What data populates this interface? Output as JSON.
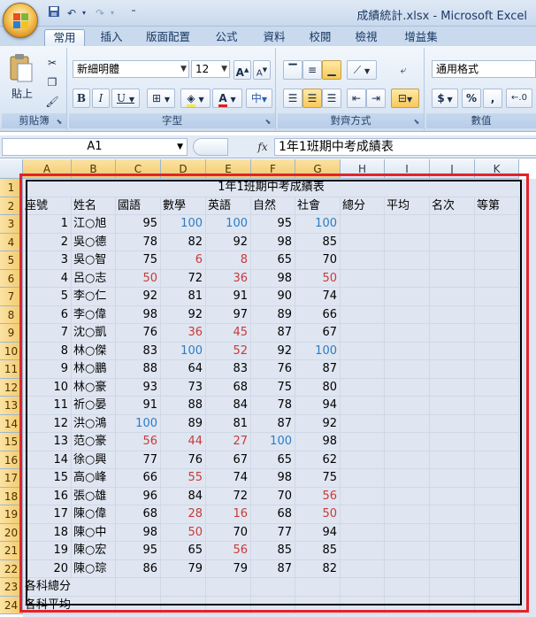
{
  "window": {
    "title": "成績統計.xlsx - Microsoft Excel"
  },
  "ribbon": {
    "tabs": [
      "常用",
      "插入",
      "版面配置",
      "公式",
      "資料",
      "校閱",
      "檢視",
      "增益集"
    ],
    "active_tab": "常用",
    "clipboard": {
      "label": "剪貼簿",
      "paste": "貼上"
    },
    "font": {
      "label": "字型",
      "name": "新細明體",
      "size": "12",
      "bold": "B",
      "italic": "I",
      "underline": "U",
      "grow": "A",
      "shrink": "A"
    },
    "alignment": {
      "label": "對齊方式"
    },
    "number": {
      "label": "數值",
      "format": "通用格式",
      "currency": "$",
      "percent": "%",
      "comma": ","
    }
  },
  "formula_bar": {
    "name_box": "A1",
    "fx": "fx",
    "content": "1年1班期中考成績表"
  },
  "columns": [
    "A",
    "B",
    "C",
    "D",
    "E",
    "F",
    "G",
    "H",
    "I",
    "J",
    "K"
  ],
  "rows": [
    "1",
    "2",
    "3",
    "4",
    "5",
    "6",
    "7",
    "8",
    "9",
    "10",
    "11",
    "12",
    "13",
    "14",
    "15",
    "16",
    "17",
    "18",
    "19",
    "20",
    "21",
    "22",
    "23",
    "24"
  ],
  "sheet": {
    "title": "1年1班期中考成績表",
    "headers": [
      "座號",
      "姓名",
      "國語",
      "數學",
      "英語",
      "自然",
      "社會",
      "總分",
      "平均",
      "名次",
      "等第"
    ],
    "students": [
      {
        "no": "1",
        "name": "江○旭",
        "scores": [
          "95",
          "100",
          "100",
          "95",
          "100"
        ]
      },
      {
        "no": "2",
        "name": "吳○德",
        "scores": [
          "78",
          "82",
          "92",
          "98",
          "85"
        ]
      },
      {
        "no": "3",
        "name": "吳○智",
        "scores": [
          "75",
          "6",
          "8",
          "65",
          "70"
        ]
      },
      {
        "no": "4",
        "name": "呂○志",
        "scores": [
          "50",
          "72",
          "36",
          "98",
          "50"
        ]
      },
      {
        "no": "5",
        "name": "李○仁",
        "scores": [
          "92",
          "81",
          "91",
          "90",
          "74"
        ]
      },
      {
        "no": "6",
        "name": "李○偉",
        "scores": [
          "98",
          "92",
          "97",
          "89",
          "66"
        ]
      },
      {
        "no": "7",
        "name": "沈○凱",
        "scores": [
          "76",
          "36",
          "45",
          "87",
          "67"
        ]
      },
      {
        "no": "8",
        "name": "林○傑",
        "scores": [
          "83",
          "100",
          "52",
          "92",
          "100"
        ]
      },
      {
        "no": "9",
        "name": "林○鵬",
        "scores": [
          "88",
          "64",
          "83",
          "76",
          "87"
        ]
      },
      {
        "no": "10",
        "name": "林○豪",
        "scores": [
          "93",
          "73",
          "68",
          "75",
          "80"
        ]
      },
      {
        "no": "11",
        "name": "祈○晏",
        "scores": [
          "91",
          "88",
          "84",
          "78",
          "94"
        ]
      },
      {
        "no": "12",
        "name": "洪○鴻",
        "scores": [
          "100",
          "89",
          "81",
          "87",
          "92"
        ]
      },
      {
        "no": "13",
        "name": "范○豪",
        "scores": [
          "56",
          "44",
          "27",
          "100",
          "98"
        ]
      },
      {
        "no": "14",
        "name": "徐○興",
        "scores": [
          "77",
          "76",
          "67",
          "65",
          "62"
        ]
      },
      {
        "no": "15",
        "name": "高○峰",
        "scores": [
          "66",
          "55",
          "74",
          "98",
          "75"
        ]
      },
      {
        "no": "16",
        "name": "張○雄",
        "scores": [
          "96",
          "84",
          "72",
          "70",
          "56"
        ]
      },
      {
        "no": "17",
        "name": "陳○偉",
        "scores": [
          "68",
          "28",
          "16",
          "68",
          "50"
        ]
      },
      {
        "no": "18",
        "name": "陳○中",
        "scores": [
          "98",
          "50",
          "70",
          "77",
          "94"
        ]
      },
      {
        "no": "19",
        "name": "陳○宏",
        "scores": [
          "95",
          "65",
          "56",
          "85",
          "85"
        ]
      },
      {
        "no": "20",
        "name": "陳○琮",
        "scores": [
          "86",
          "79",
          "79",
          "87",
          "82"
        ]
      }
    ],
    "summary_rows": [
      "各科總分",
      "各科平均"
    ]
  },
  "colors": {
    "score_100": "#2d7bc3",
    "score_fail": "#c83a3a",
    "highlight_frame": "#e3232a"
  }
}
